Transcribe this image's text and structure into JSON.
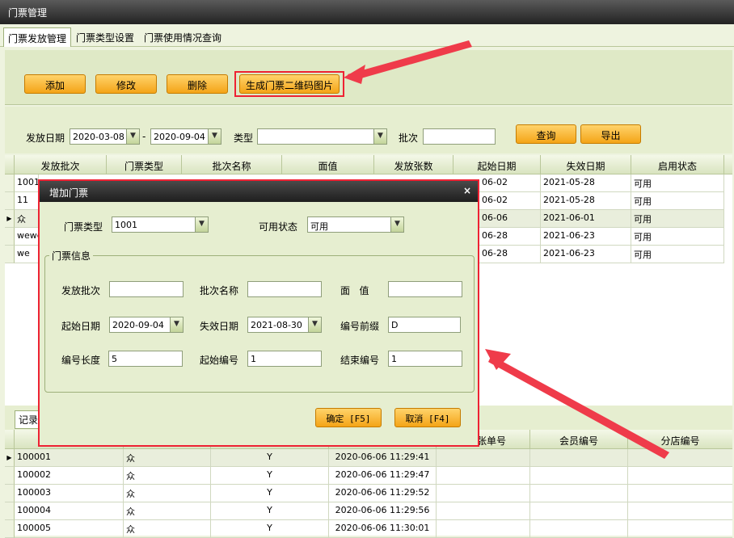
{
  "window": {
    "title": "门票管理"
  },
  "tabs": [
    "门票发放管理",
    "门票类型设置",
    "门票使用情况查询"
  ],
  "toolbar": {
    "add": "添加",
    "edit": "修改",
    "delete": "删除",
    "qr": "生成门票二维码图片"
  },
  "filter": {
    "date_label": "发放日期",
    "date_from": "2020-03-08",
    "date_sep": "-",
    "date_to": "2020-09-04",
    "type_label": "类型",
    "type_value": "",
    "batch_label": "批次",
    "batch_value": "",
    "query": "查询",
    "export": "导出"
  },
  "batch_grid": {
    "headers": [
      "发放批次",
      "门票类型",
      "批次名称",
      "面值",
      "发放张数",
      "起始日期",
      "失效日期",
      "启用状态"
    ],
    "rows": [
      {
        "batch": "1001",
        "start": "06-02",
        "end": "2021-05-28",
        "status": "可用"
      },
      {
        "batch": "11",
        "start": "06-02",
        "end": "2021-05-28",
        "status": "可用"
      },
      {
        "batch": "众",
        "start": "06-06",
        "end": "2021-06-01",
        "status": "可用"
      },
      {
        "batch": "wewe",
        "start": "06-28",
        "end": "2021-06-23",
        "status": "可用"
      },
      {
        "batch": "we",
        "start": "06-28",
        "end": "2021-06-23",
        "status": "可用"
      }
    ]
  },
  "lower": {
    "tab_fragment": "记录",
    "headers": [
      "张单号",
      "会员编号",
      "分店编号"
    ],
    "rows": [
      {
        "code": "100001",
        "batch": "众",
        "flag": "Y",
        "time": "2020-06-06 11:29:41"
      },
      {
        "code": "100002",
        "batch": "众",
        "flag": "Y",
        "time": "2020-06-06 11:29:47"
      },
      {
        "code": "100003",
        "batch": "众",
        "flag": "Y",
        "time": "2020-06-06 11:29:52"
      },
      {
        "code": "100004",
        "batch": "众",
        "flag": "Y",
        "time": "2020-06-06 11:29:56"
      },
      {
        "code": "100005",
        "batch": "众",
        "flag": "Y",
        "time": "2020-06-06 11:30:01"
      }
    ]
  },
  "dialog": {
    "title": "增加门票",
    "close": "×",
    "ticket_type_label": "门票类型",
    "ticket_type_value": "1001",
    "status_label": "可用状态",
    "status_value": "可用",
    "group_title": "门票信息",
    "batch_label": "发放批次",
    "batch_value": "",
    "batch_name_label": "批次名称",
    "batch_name_value": "",
    "face_label": "面   值",
    "face_value": "",
    "start_label": "起始日期",
    "start_value": "2020-09-04",
    "end_label": "失效日期",
    "end_value": "2021-08-30",
    "prefix_label": "编号前缀",
    "prefix_value": "D",
    "length_label": "编号长度",
    "length_value": "5",
    "start_no_label": "起始编号",
    "start_no_value": "1",
    "end_no_label": "结束编号",
    "end_no_value": "1",
    "ok": "确定 [F5]",
    "cancel": "取消 [F4]"
  },
  "colors": {
    "accent_red": "#e23",
    "button_orange": "#f4a417"
  }
}
